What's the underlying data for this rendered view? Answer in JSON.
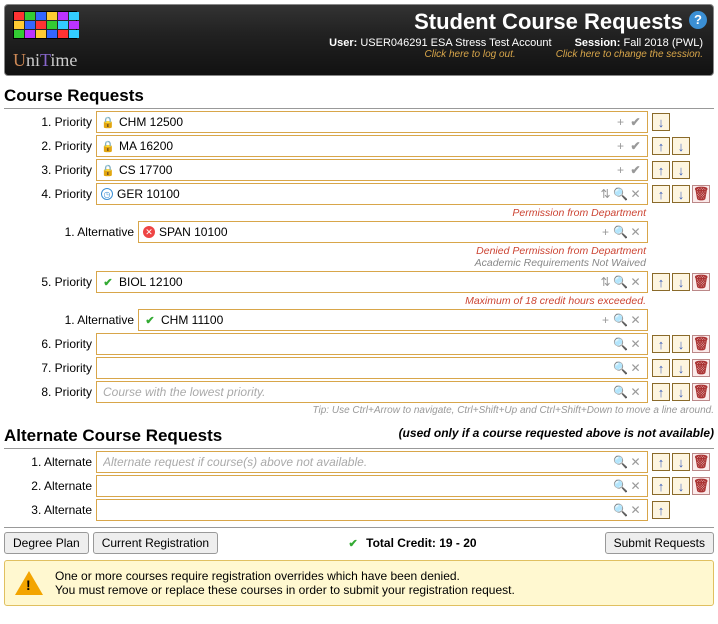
{
  "header": {
    "title": "Student Course Requests",
    "user_label": "User:",
    "user_value": "USER046291 ESA Stress Test Account",
    "logout_hint": "Click here to log out.",
    "session_label": "Session:",
    "session_value": "Fall 2018 (PWL)",
    "session_hint": "Click here to change the session."
  },
  "sections": {
    "course_requests": "Course Requests",
    "alternate_requests": "Alternate Course Requests",
    "alternate_sub": "(used only if a course requested above is not available)"
  },
  "priorities": [
    {
      "num": "1.",
      "label": "Priority",
      "value": "CHM 12500",
      "pre_icon": "lock",
      "trail": "plus-check",
      "ctrls": [
        "down"
      ]
    },
    {
      "num": "2.",
      "label": "Priority",
      "value": "MA 16200",
      "pre_icon": "lock",
      "trail": "plus-check",
      "ctrls": [
        "up",
        "down"
      ]
    },
    {
      "num": "3.",
      "label": "Priority",
      "value": "CS 17700",
      "pre_icon": "lock",
      "trail": "plus-check",
      "ctrls": [
        "up",
        "down"
      ]
    },
    {
      "num": "4.",
      "label": "Priority",
      "value": "GER 10100",
      "pre_icon": "clock",
      "trail": "updown-mag-x",
      "ctrls": [
        "up",
        "down",
        "del"
      ],
      "status": "Permission from Department"
    },
    {
      "num": "5.",
      "label": "Priority",
      "value": "BIOL 12100",
      "pre_icon": "check",
      "trail": "updown-mag-x",
      "ctrls": [
        "up",
        "down",
        "del"
      ],
      "status": "Maximum of 18 credit hours exceeded."
    },
    {
      "num": "6.",
      "label": "Priority",
      "value": "",
      "trail": "mag-x",
      "ctrls": [
        "up",
        "down",
        "del"
      ]
    },
    {
      "num": "7.",
      "label": "Priority",
      "value": "",
      "trail": "mag-x",
      "ctrls": [
        "up",
        "down",
        "del"
      ]
    },
    {
      "num": "8.",
      "label": "Priority",
      "value": "",
      "placeholder": "Course with the lowest priority.",
      "trail": "mag-x",
      "ctrls": [
        "up",
        "down",
        "del"
      ]
    }
  ],
  "alternatives": [
    {
      "after_priority": 4,
      "num": "1.",
      "label": "Alternative",
      "value": "SPAN 10100",
      "pre_icon": "x-red",
      "trail": "plus-mag-x",
      "status1": "Denied Permission from Department",
      "status2": "Academic Requirements Not Waived"
    },
    {
      "after_priority": 5,
      "num": "1.",
      "label": "Alternative",
      "value": "CHM 11100",
      "pre_icon": "check",
      "trail": "plus-mag-x"
    }
  ],
  "alt_requests": [
    {
      "num": "1.",
      "label": "Alternate",
      "placeholder": "Alternate request if course(s) above not available.",
      "ctrls": [
        "up",
        "down",
        "del"
      ]
    },
    {
      "num": "2.",
      "label": "Alternate",
      "ctrls": [
        "up",
        "down",
        "del"
      ]
    },
    {
      "num": "3.",
      "label": "Alternate",
      "ctrls": [
        "up"
      ]
    }
  ],
  "tip": "Tip: Use Ctrl+Arrow to navigate, Ctrl+Shift+Up and Ctrl+Shift+Down to move a line around.",
  "footer": {
    "degree_plan": "Degree Plan",
    "current_reg": "Current Registration",
    "total_label": "Total Credit:",
    "total_value": "19 - 20",
    "submit": "Submit Requests"
  },
  "warning": {
    "line1": "One or more courses require registration overrides which have been denied.",
    "line2": "You must remove or replace these courses in order to submit your registration request."
  }
}
